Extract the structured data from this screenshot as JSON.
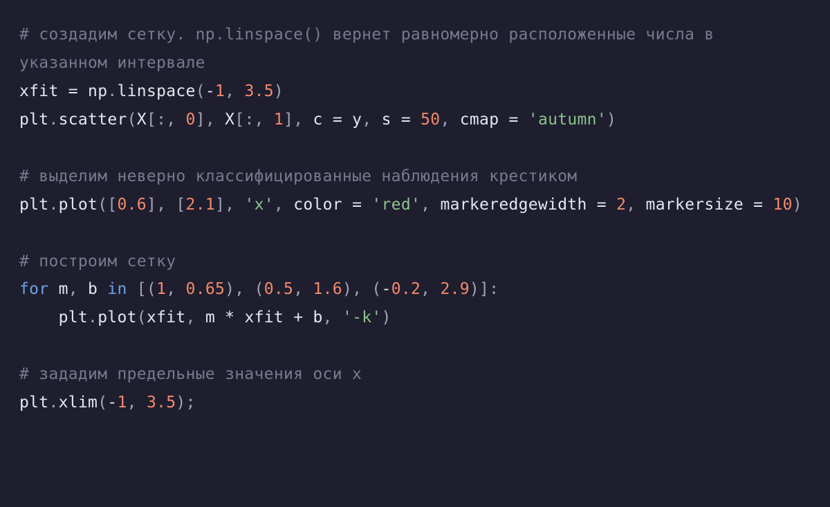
{
  "code": {
    "tokens": [
      {
        "cls": "c",
        "t": "# создадим сетку. np.linspace() вернет равномерно расположенные числа в указанном интервале"
      },
      {
        "cls": null,
        "t": "\n"
      },
      {
        "cls": "n",
        "t": "xfit "
      },
      {
        "cls": "p",
        "t": "= "
      },
      {
        "cls": "n",
        "t": "np"
      },
      {
        "cls": "g",
        "t": "."
      },
      {
        "cls": "n",
        "t": "linspace"
      },
      {
        "cls": "g",
        "t": "("
      },
      {
        "cls": "p",
        "t": "-"
      },
      {
        "cls": "num",
        "t": "1"
      },
      {
        "cls": "g",
        "t": ", "
      },
      {
        "cls": "num",
        "t": "3.5"
      },
      {
        "cls": "g",
        "t": ")"
      },
      {
        "cls": null,
        "t": "\n"
      },
      {
        "cls": "n",
        "t": "plt"
      },
      {
        "cls": "g",
        "t": "."
      },
      {
        "cls": "n",
        "t": "scatter"
      },
      {
        "cls": "g",
        "t": "("
      },
      {
        "cls": "n",
        "t": "X"
      },
      {
        "cls": "g",
        "t": "[:, "
      },
      {
        "cls": "num",
        "t": "0"
      },
      {
        "cls": "g",
        "t": "], "
      },
      {
        "cls": "n",
        "t": "X"
      },
      {
        "cls": "g",
        "t": "[:, "
      },
      {
        "cls": "num",
        "t": "1"
      },
      {
        "cls": "g",
        "t": "], "
      },
      {
        "cls": "n",
        "t": "c "
      },
      {
        "cls": "p",
        "t": "= "
      },
      {
        "cls": "n",
        "t": "y"
      },
      {
        "cls": "g",
        "t": ", "
      },
      {
        "cls": "n",
        "t": "s "
      },
      {
        "cls": "p",
        "t": "= "
      },
      {
        "cls": "num",
        "t": "50"
      },
      {
        "cls": "g",
        "t": ", "
      },
      {
        "cls": "n",
        "t": "cmap "
      },
      {
        "cls": "p",
        "t": "= "
      },
      {
        "cls": "s",
        "t": "'autumn'"
      },
      {
        "cls": "g",
        "t": ")"
      },
      {
        "cls": null,
        "t": "\n"
      },
      {
        "cls": null,
        "t": "\n"
      },
      {
        "cls": "c",
        "t": "# выделим неверно классифицированные наблюдения крестиком"
      },
      {
        "cls": null,
        "t": "\n"
      },
      {
        "cls": "n",
        "t": "plt"
      },
      {
        "cls": "g",
        "t": "."
      },
      {
        "cls": "n",
        "t": "plot"
      },
      {
        "cls": "g",
        "t": "(["
      },
      {
        "cls": "num",
        "t": "0.6"
      },
      {
        "cls": "g",
        "t": "], ["
      },
      {
        "cls": "num",
        "t": "2.1"
      },
      {
        "cls": "g",
        "t": "], "
      },
      {
        "cls": "s",
        "t": "'x'"
      },
      {
        "cls": "g",
        "t": ", "
      },
      {
        "cls": "n",
        "t": "color "
      },
      {
        "cls": "p",
        "t": "= "
      },
      {
        "cls": "s",
        "t": "'red'"
      },
      {
        "cls": "g",
        "t": ", "
      },
      {
        "cls": "n",
        "t": "markeredgewidth "
      },
      {
        "cls": "p",
        "t": "= "
      },
      {
        "cls": "num",
        "t": "2"
      },
      {
        "cls": "g",
        "t": ", "
      },
      {
        "cls": "n",
        "t": "markersize "
      },
      {
        "cls": "p",
        "t": "= "
      },
      {
        "cls": "num",
        "t": "10"
      },
      {
        "cls": "g",
        "t": ")"
      },
      {
        "cls": null,
        "t": "\n"
      },
      {
        "cls": null,
        "t": "\n"
      },
      {
        "cls": "c",
        "t": "# построим сетку"
      },
      {
        "cls": null,
        "t": "\n"
      },
      {
        "cls": "kw",
        "t": "for"
      },
      {
        "cls": "n",
        "t": " m"
      },
      {
        "cls": "g",
        "t": ", "
      },
      {
        "cls": "n",
        "t": "b "
      },
      {
        "cls": "kw",
        "t": "in"
      },
      {
        "cls": "g",
        "t": " [("
      },
      {
        "cls": "num",
        "t": "1"
      },
      {
        "cls": "g",
        "t": ", "
      },
      {
        "cls": "num",
        "t": "0.65"
      },
      {
        "cls": "g",
        "t": "), ("
      },
      {
        "cls": "num",
        "t": "0.5"
      },
      {
        "cls": "g",
        "t": ", "
      },
      {
        "cls": "num",
        "t": "1.6"
      },
      {
        "cls": "g",
        "t": "), ("
      },
      {
        "cls": "p",
        "t": "-"
      },
      {
        "cls": "num",
        "t": "0.2"
      },
      {
        "cls": "g",
        "t": ", "
      },
      {
        "cls": "num",
        "t": "2.9"
      },
      {
        "cls": "g",
        "t": ")]:"
      },
      {
        "cls": null,
        "t": "\n"
      },
      {
        "cls": null,
        "t": "    "
      },
      {
        "cls": "n",
        "t": "plt"
      },
      {
        "cls": "g",
        "t": "."
      },
      {
        "cls": "n",
        "t": "plot"
      },
      {
        "cls": "g",
        "t": "("
      },
      {
        "cls": "n",
        "t": "xfit"
      },
      {
        "cls": "g",
        "t": ", "
      },
      {
        "cls": "n",
        "t": "m "
      },
      {
        "cls": "p",
        "t": "* "
      },
      {
        "cls": "n",
        "t": "xfit "
      },
      {
        "cls": "p",
        "t": "+ "
      },
      {
        "cls": "n",
        "t": "b"
      },
      {
        "cls": "g",
        "t": ", "
      },
      {
        "cls": "s",
        "t": "'-k'"
      },
      {
        "cls": "g",
        "t": ")"
      },
      {
        "cls": null,
        "t": "\n"
      },
      {
        "cls": null,
        "t": "\n"
      },
      {
        "cls": "c",
        "t": "# зададим предельные значения оси x"
      },
      {
        "cls": null,
        "t": "\n"
      },
      {
        "cls": "n",
        "t": "plt"
      },
      {
        "cls": "g",
        "t": "."
      },
      {
        "cls": "n",
        "t": "xlim"
      },
      {
        "cls": "g",
        "t": "("
      },
      {
        "cls": "p",
        "t": "-"
      },
      {
        "cls": "num",
        "t": "1"
      },
      {
        "cls": "g",
        "t": ", "
      },
      {
        "cls": "num",
        "t": "3.5"
      },
      {
        "cls": "g",
        "t": ");"
      }
    ]
  }
}
